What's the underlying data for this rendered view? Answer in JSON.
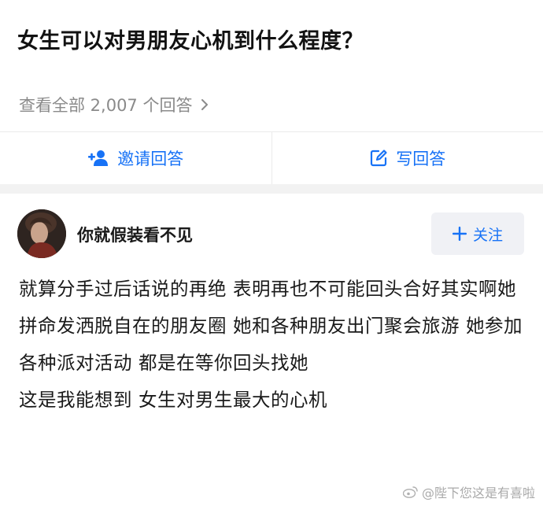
{
  "question": {
    "title": "女生可以对男朋友心机到什么程度？"
  },
  "answers_link": {
    "text": "查看全部 2,007 个回答"
  },
  "actions": {
    "invite_label": "邀请回答",
    "write_label": "写回答"
  },
  "author": {
    "name": "你就假装看不见",
    "follow_label": "关注"
  },
  "answer": {
    "paragraphs": [
      "就算分手过后话说的再绝 表明再也不可能回头合好其实啊她拼命发洒脱自在的朋友圈 她和各种朋友出门聚会旅游 她参加各种派对活动 都是在等你回头找她",
      "这是我能想到 女生对男生最大的心机"
    ]
  },
  "watermark": {
    "text": "@陛下您这是有喜啦"
  },
  "colors": {
    "accent": "#1772f6",
    "muted": "#8a8a8a"
  }
}
